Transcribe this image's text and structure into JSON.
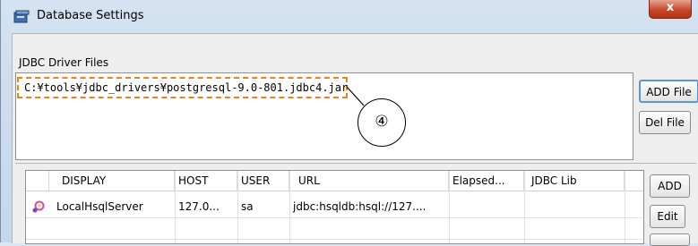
{
  "window": {
    "title": "Database Settings",
    "close_label": "x"
  },
  "jdbc_group": {
    "label": "JDBC Driver Files",
    "files": [
      "C:¥tools¥jdbc_drivers¥postgresql-9.0-801.jdbc4.jar"
    ],
    "callout": "④"
  },
  "buttons": {
    "add_file": "ADD File",
    "del_file": "Del File",
    "add": "ADD",
    "edit": "Edit"
  },
  "table": {
    "columns": [
      "DISPLAY",
      "HOST",
      "USER",
      "URL",
      "Elapsed...",
      "JDBC Lib"
    ],
    "rows": [
      {
        "display": "LocalHsqlServer",
        "host": "127.0...",
        "user": "sa",
        "url": "jdbc:hsqldb:hsql://127....",
        "elapsed": "",
        "jdbc_lib": ""
      }
    ]
  },
  "colors": {
    "accent": "#f0801a",
    "title_bar": "#c5d7ec",
    "close": "#c9472b"
  }
}
